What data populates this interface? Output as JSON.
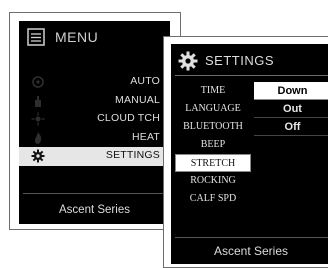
{
  "menu_panel": {
    "title": "MENU",
    "icon": "menu-list-icon",
    "items": [
      {
        "label": "AUTO",
        "icon": "auto-icon"
      },
      {
        "label": "MANUAL",
        "icon": "manual-hand-icon"
      },
      {
        "label": "CLOUD TCH",
        "icon": "cloud-touch-icon"
      },
      {
        "label": "HEAT",
        "icon": "heat-flame-icon"
      },
      {
        "label": "SETTINGS",
        "icon": "gear-icon",
        "selected": true
      }
    ],
    "footer": "Ascent Series"
  },
  "settings_panel": {
    "title": "SETTINGS",
    "icon": "gear-icon",
    "items": [
      {
        "label": "TIME"
      },
      {
        "label": "LANGUAGE"
      },
      {
        "label": "BLUETOOTH"
      },
      {
        "label": "BEEP"
      },
      {
        "label": "STRETCH",
        "selected": true
      },
      {
        "label": "ROCKING"
      },
      {
        "label": "CALF SPD"
      }
    ],
    "values": [
      {
        "label": "Down",
        "selected": true
      },
      {
        "label": "Out"
      },
      {
        "label": "Off"
      }
    ],
    "footer": "Ascent Series"
  },
  "colors": {
    "screen_bg": "#000000",
    "highlight": "#e6e6e6",
    "text_light": "#dedede"
  }
}
